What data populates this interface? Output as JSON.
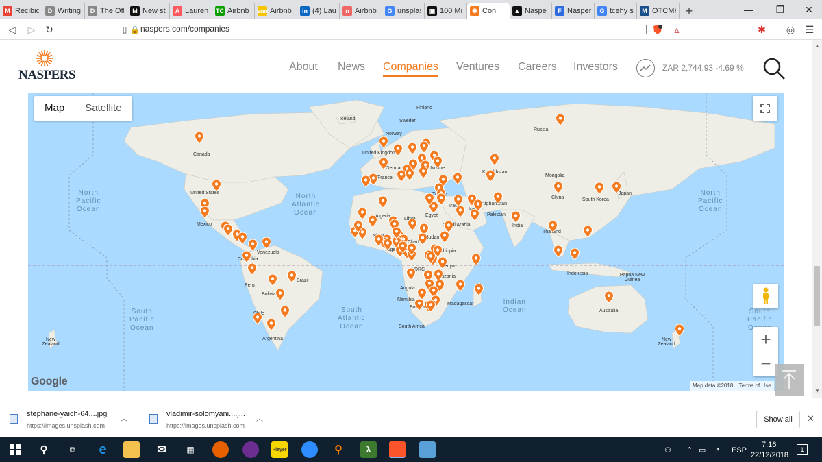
{
  "browser": {
    "tabs": [
      {
        "label": "Recibid",
        "fav": "M",
        "color": "#ea4335"
      },
      {
        "label": "Writing",
        "fav": "D",
        "color": "#888"
      },
      {
        "label": "The Off",
        "fav": "D",
        "color": "#888"
      },
      {
        "label": "New st",
        "fav": "M",
        "color": "#111"
      },
      {
        "label": "Lauren",
        "fav": "A",
        "color": "#ff5a5f"
      },
      {
        "label": "Airbnb",
        "fav": "TC",
        "color": "#0a9e01"
      },
      {
        "label": "Airbnb",
        "fav": "sun",
        "color": "#f7c600"
      },
      {
        "label": "(4) Laur",
        "fav": "in",
        "color": "#0a66c2"
      },
      {
        "label": "Airbnb",
        "fav": "n",
        "color": "#e66"
      },
      {
        "label": "unsplas",
        "fav": "G",
        "color": "#4285f4"
      },
      {
        "label": "100 Mi",
        "fav": "▣",
        "color": "#111"
      },
      {
        "label": "Con",
        "fav": "✺",
        "color": "#f47b20",
        "active": true
      },
      {
        "label": "Naspe",
        "fav": "▲",
        "color": "#111"
      },
      {
        "label": "Nasper",
        "fav": "F",
        "color": "#2d6cdf"
      },
      {
        "label": "tcehy s",
        "fav": "G",
        "color": "#4285f4"
      },
      {
        "label": "OTCMK",
        "fav": "M",
        "color": "#1a4f8b"
      }
    ],
    "new_tab": "+",
    "minimize": "—",
    "maximize": "❐",
    "close": "✕",
    "url": "naspers.com/companies"
  },
  "site": {
    "logo_text": "NASPERS",
    "nav": [
      {
        "label": "About"
      },
      {
        "label": "News"
      },
      {
        "label": "Companies",
        "active": true
      },
      {
        "label": "Ventures"
      },
      {
        "label": "Careers"
      },
      {
        "label": "Investors"
      }
    ],
    "stock": "ZAR 2,744.93  -4.69 %"
  },
  "map": {
    "type_buttons": [
      "Map",
      "Satellite"
    ],
    "selected_type": "Map",
    "zoom_in": "+",
    "zoom_out": "−",
    "google": "Google",
    "attribution": "Map data ©2018",
    "terms": "Terms of Use",
    "marker_color": "#f47b20",
    "labels": {
      "finland": "Finland",
      "iceland": "Iceland",
      "sweden": "Sweden",
      "norway": "Norway",
      "russia": "Russia",
      "uk": "United Kingdom",
      "germany": "Germany",
      "france": "France",
      "ukraine": "Ukraine",
      "kazakhstan": "Kazakhstan",
      "mongolia": "Mongolia",
      "canada": "Canada",
      "usa": "United States",
      "mexico": "Mexico",
      "turkey": "Turkey",
      "iraq": "Iraq",
      "iran": "Iran",
      "afghanistan": "Afghanistan",
      "pakistan": "Pakistan",
      "china": "China",
      "south_korea": "South Korea",
      "japan": "Japan",
      "india": "India",
      "thailand": "Thailand",
      "libya": "Libya",
      "algeria": "Algeria",
      "egypt": "Egypt",
      "saudi": "Saudi Arabia",
      "niger": "Niger",
      "chad": "Chad",
      "sudan": "Sudan",
      "nigeria": "Nigeria",
      "ethiopia": "Ethiopia",
      "kenya": "Kenya",
      "drc": "DRC",
      "tanzania": "Tanzania",
      "angola": "Angola",
      "namibia": "Namibia",
      "botswana": "Botswana",
      "madagascar": "Madagascar",
      "south_africa": "South Africa",
      "venezuela": "Venezuela",
      "colombia": "Colombia",
      "peru": "Peru",
      "brazil": "Brazil",
      "bolivia": "Bolivia",
      "chile": "Chile",
      "argentina": "Argentina",
      "indonesia": "Indonesia",
      "png": "Papua New Guinea",
      "australia": "Australia",
      "nz_left": "New Zealand",
      "nz_right": "New Zealand",
      "spain": "Spain",
      "italy": "Italy",
      "poland": "Poland"
    },
    "oceans": {
      "npacific_l": "North\nPacific\nOcean",
      "npacific_r": "North\nPacific\nOcean",
      "natlantic": "North\nAtlantic\nOcean",
      "spacific_l": "South\nPacific\nOcean",
      "spacific_r": "South\nPacific\nOcean",
      "satlantic": "South\nAtlantic\nOcean",
      "indian": "Indian\nOcean"
    }
  },
  "downloads": [
    {
      "name": "stephane-yaich-64....jpg",
      "url": "https://images.unsplash.com"
    },
    {
      "name": "vladimir-solomyani....j...",
      "url": "https://images.unsplash.com"
    }
  ],
  "show_all": "Show all",
  "taskbar": {
    "lang": "ESP",
    "time": "7:16",
    "date": "22/12/2018",
    "notif_count": "1"
  }
}
